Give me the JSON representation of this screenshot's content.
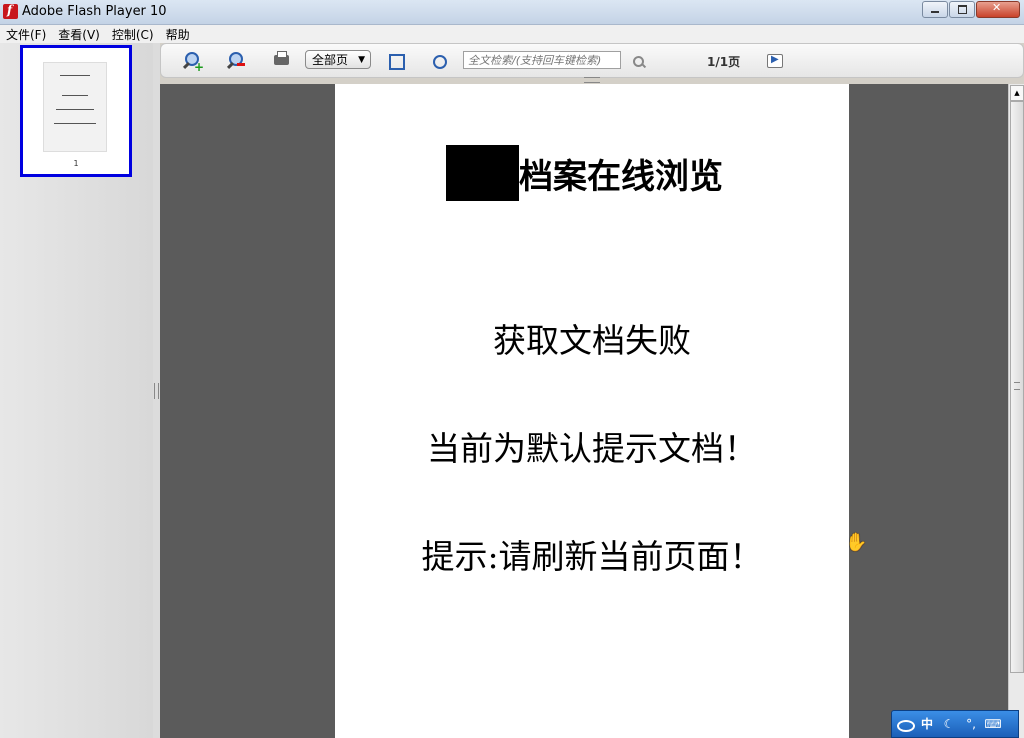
{
  "window": {
    "title": "Adobe Flash Player 10"
  },
  "menu": {
    "items": [
      "文件(F)",
      "查看(V)",
      "控制(C)",
      "帮助"
    ]
  },
  "thumbnail": {
    "page_number": "1"
  },
  "toolbar": {
    "zoom_mode": "全部页",
    "search_placeholder": "全文检索/(支持回车键检索)",
    "page_counter": "1/1页",
    "icons": [
      "zoom-in-icon",
      "zoom-out-icon",
      "print-icon",
      "fit-page-icon",
      "fit-width-icon",
      "search-icon",
      "next-page-icon"
    ]
  },
  "document": {
    "title": "档案在线浏览",
    "line1": "获取文档失败",
    "line2": "当前为默认提示文档！",
    "line3": "提示:请刷新当前页面！"
  },
  "ime": {
    "lang": "中",
    "icons": [
      "ime-logo-icon",
      "moon-icon",
      "punctuation-icon",
      "keyboard-icon",
      "settings-icon"
    ]
  },
  "colors": {
    "thumbnail_selection": "#0000e0",
    "viewer_background": "#5b5b5b"
  }
}
